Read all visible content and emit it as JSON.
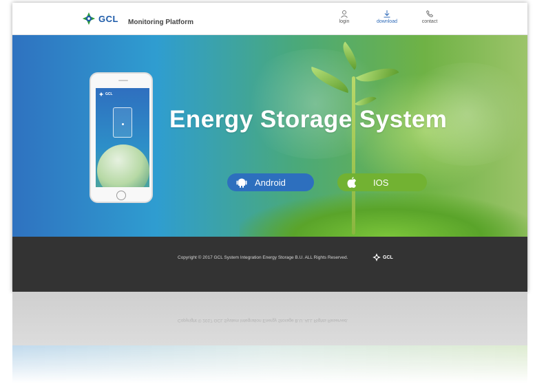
{
  "header": {
    "logo_text": "GCL",
    "platform_title": "Monitoring Platform",
    "nav": [
      {
        "label": "login",
        "icon": "user-icon"
      },
      {
        "label": "download",
        "icon": "download-icon",
        "active": true
      },
      {
        "label": "contact",
        "icon": "phone-icon"
      }
    ]
  },
  "hero": {
    "title": "Energy Storage System",
    "phone_logo_text": "GCL",
    "buttons": {
      "android": "Android",
      "ios": "IOS"
    }
  },
  "footer": {
    "copyright": "Copyright © 2017 GCL System Integration Energy Storage B.U. ALL Rights Reserved.",
    "logo_text": "GCL"
  },
  "colors": {
    "brand_blue": "#1c5aa8",
    "android_button": "#2d6fbe",
    "ios_button": "#72b232",
    "footer_bg": "#333333"
  }
}
